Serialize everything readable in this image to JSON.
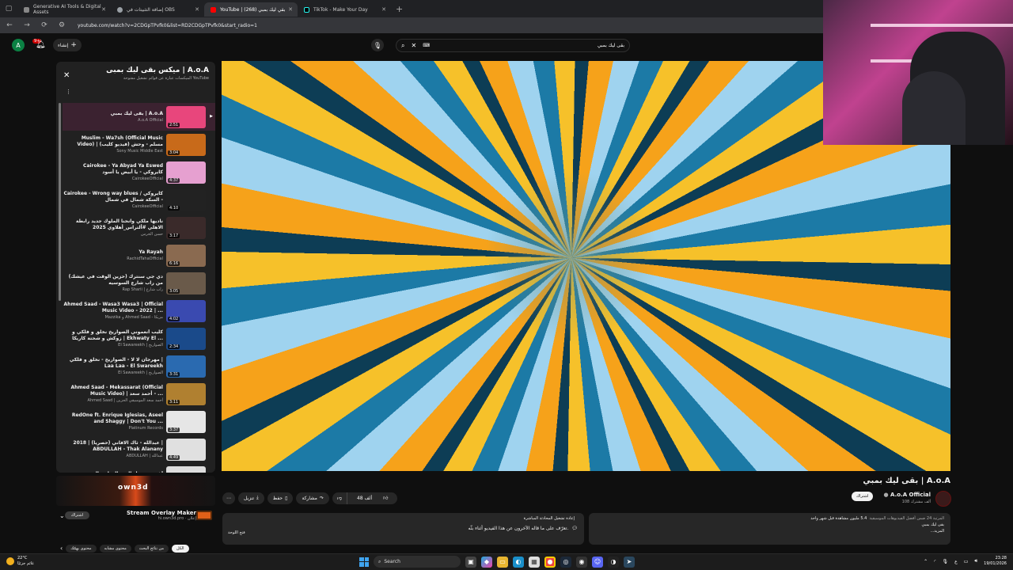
{
  "browser": {
    "tabs": [
      {
        "title": "Generative AI Tools & Digital Assets",
        "fav": "#888888"
      },
      {
        "title": "إضافة التثبيتات في OBS",
        "fav": "#9aa0a6"
      },
      {
        "title": "YouTube | بقي ليك بمبي (268)",
        "fav": "#ff0000"
      },
      {
        "title": "TikTok - Make Your Day",
        "fav": "#000000"
      }
    ],
    "url": "youtube.com/watch?v=2CDGpTPvfk0&list=RD2CDGpTPvfk0&start_radio=1"
  },
  "header": {
    "avatar_letter": "A",
    "notif_count": "9+",
    "create_label": "إنشاء",
    "search_value": "بقى ليك بمبي"
  },
  "playlist": {
    "title": "ميكس بقى ليك بمبى | A.o.A",
    "subtitle": "الميكسات عبارة عن قوائم تشغيل مفتوحة YouTube",
    "items": [
      {
        "title": "بقى ليك بمبي | A.o.A",
        "channel": "A.o.A Official",
        "duration": "2:51",
        "color": "#e8467c"
      },
      {
        "title": "Muslim - Wa7sh (Official Music Video) | مسلم - وحش (فيديو كليب)",
        "channel": "Sony Music Middle East",
        "duration": "3:04",
        "color": "#c86a1a"
      },
      {
        "title": "Cairokee - Ya Abyad Ya Eswed كايروكي - يا أبيض يا أسود",
        "channel": "CairokeeOfficial",
        "duration": "4:37",
        "color": "#e6a0d0"
      },
      {
        "title": "Cairokee - Wrong way blues / كايروكي - السكة شمال في شمال",
        "channel": "CairokeeOfficial",
        "duration": "4:10",
        "color": "#222222"
      },
      {
        "title": "ناديها ملكي وانحنا الملوك جديد رابطة الاهلي #ألتراس_أهلاوي 2025",
        "channel": "حسن الخرس",
        "duration": "3:17",
        "color": "#3a2a2a"
      },
      {
        "title": "Ya Rayah",
        "channel": "RachidTahaOfficial",
        "duration": "6:16",
        "color": "#8a6a50"
      },
      {
        "title": "دي جي سنترك (حزين الوقت في عيشك) من راب شارع السوسيه",
        "channel": "Rap Sharii | راب شارع",
        "duration": "3:05",
        "color": "#6a5a4a"
      },
      {
        "title": "Ahmed Saad - Wasa3 Wasa3 | Official Music Video - 2022 | ...",
        "channel": "Mazzika و Ahmed Saad - مزيكا",
        "duration": "4:02",
        "color": "#3a4ab0"
      },
      {
        "title": "كليب أنعموني الصواريخ نخلق و فلكي و زوكش و شحتة كاريكا | Ekhwaty El ...",
        "channel": "El Sawareekh | الصواريخ",
        "duration": "2:34",
        "color": "#1a4a8a"
      },
      {
        "title": "مهرجان لا لا - الصواريخ - نخلق و فلكي | Laa Laa - El Swareekh",
        "channel": "El Sawareekh | الصواريخ",
        "duration": "3:31",
        "color": "#2a6ab0"
      },
      {
        "title": "Ahmed Saad - Mekassarat (Official Music Video) | أحمد سعد - ...",
        "channel": "Ahmed Saad | أحمد سعد الموسيقي الحزين",
        "duration": "3:11",
        "color": "#b08030"
      },
      {
        "title": "RedOne ft. Enrique Iglesias, Aseel and Shaggy | Don't You ...",
        "channel": "Platinum Records",
        "duration": "3:37",
        "color": "#e6e6e6"
      },
      {
        "title": "عبدالله - ثاك الافاني (حصرياً) | 2018 | ABDULLAH - Thak Alanany",
        "channel": "ABDULLAH | عبدالله",
        "duration": "4:49",
        "color": "#e0e0e0"
      },
      {
        "title": "أغنية برسول اليوم الوطني السعودي",
        "channel": "...",
        "duration": "",
        "color": "#dddddd"
      }
    ]
  },
  "ad": {
    "logo": "own3d",
    "title": "Stream Overlay Maker",
    "sponsor": "إعلان",
    "domain": "hi.own3d.pro",
    "cta": "اشتراك"
  },
  "chips": [
    "الكل",
    "من نتائج البحث",
    "محتوى مشابه",
    "محتوى يهمّك"
  ],
  "video": {
    "title": "بقى ليك بمبي | A.o.A",
    "channel": "A.o.A Official",
    "subscribers": "108 ألف مشترك",
    "subscribe_label": "اشتراك",
    "likes": "48 ألف",
    "share": "مشاركة",
    "save": "حفظ",
    "download": "تنزيل",
    "views_line": "5.4 مليون مشاهدة قبل شهر واحد",
    "desc_tail": "المرتبة 24 ضمن أفضل الفيديوهات الموسيقية",
    "desc_line2": "بقى ليك بمبي",
    "desc_more": "...المزيد"
  },
  "live_chat": {
    "header": "إعادة تشغيل المحادثة المباشرة",
    "prompt": "تعرّف على ما قاله الآخرون عن هذا الفيديو أثناء بثّه.",
    "open": "فتح اللوحة"
  },
  "taskbar": {
    "temp": "22°C",
    "weather": "غائم جزئيًا",
    "search": "Search",
    "time": "23:28",
    "date": "19/01/2026",
    "lang": "ع"
  }
}
